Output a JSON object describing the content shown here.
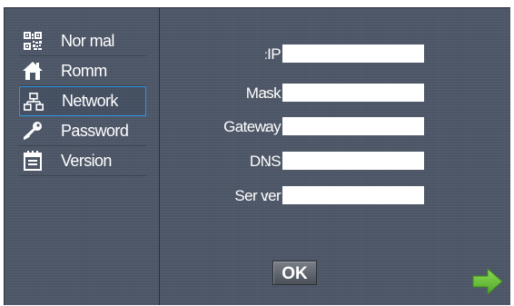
{
  "sidebar": {
    "items": [
      {
        "label": "Nor mal",
        "icon": "qr-code-icon"
      },
      {
        "label": "Romm",
        "icon": "home-icon"
      },
      {
        "label": "Network",
        "icon": "network-icon",
        "selected": true
      },
      {
        "label": "Password",
        "icon": "key-icon"
      },
      {
        "label": "Version",
        "icon": "calendar-icon"
      }
    ]
  },
  "form": {
    "fields": [
      {
        "label": "IP",
        "value": ""
      },
      {
        "label": "Mask",
        "value": ""
      },
      {
        "label": "Gateway",
        "value": ""
      },
      {
        "label": "DNS",
        "value": ""
      },
      {
        "label": "Ser ver",
        "value": ""
      }
    ],
    "colon": ":"
  },
  "actions": {
    "ok_label": "OK",
    "next_icon": "arrow-right-icon"
  },
  "colors": {
    "background": "#4e5768",
    "selection_border": "#2e96e6",
    "next_arrow": "#6ec13e"
  }
}
